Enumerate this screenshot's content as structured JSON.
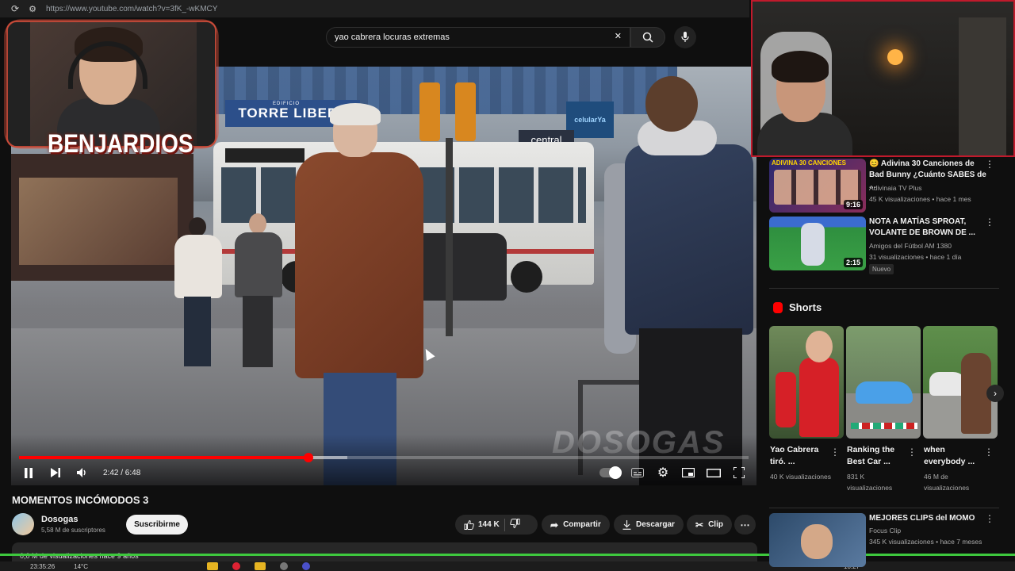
{
  "browser": {
    "url": "https://www.youtube.com/watch?v=3fK_-wKMCY"
  },
  "search": {
    "query": "yao cabrera locuras extremas"
  },
  "overlay": {
    "streamer_name": "BENJARDIOS"
  },
  "video": {
    "watermark": "DOSOGAS",
    "signs": {
      "building": "TORRE LIBERT",
      "building_sub": "EDIFICIO",
      "shop": "central",
      "shop2": "celularYa",
      "left_sign": "AD"
    },
    "time": "2:42 / 6:48",
    "progress_fraction": 0.397,
    "buffered_fraction": 0.45
  },
  "info": {
    "title": "MOMENTOS INCÓMODOS 3",
    "channel": "Dosogas",
    "subscribers": "5,58 M de suscriptores",
    "subscribe_label": "Suscribirme",
    "likes": "144 K",
    "share_label": "Compartir",
    "download_label": "Descargar",
    "clip_label": "Clip",
    "views_line": "0,0 M de visualizaciones  hace 9 años"
  },
  "sidebar": {
    "videos": [
      {
        "title": "😊 Adivina 30 Canciones de Bad Bunny ¿Cuánto SABES de ...",
        "channel": "Adivinaia TV Plus",
        "meta": "45 K visualizaciones • hace 1 mes",
        "duration": "9:16",
        "thumb_text": "ADIVINA 30 CANCIONES"
      },
      {
        "title": "NOTA A MATÍAS SPROAT, VOLANTE DE BROWN DE ...",
        "channel": "Amigos del Fútbol AM 1380",
        "meta": "31 visualizaciones • hace 1 día",
        "duration": "2:15",
        "badge": "Nuevo"
      },
      {
        "title": "MEJORES CLIPS del MOMO",
        "channel": "Focus Clip",
        "meta": "345 K visualizaciones • hace 7 meses"
      }
    ],
    "shorts_heading": "Shorts",
    "shorts": [
      {
        "title": "Yao Cabrera tiró. ...",
        "views": "40 K visualizaciones"
      },
      {
        "title": "Ranking the Best Car ...",
        "views": "831 K visualizaciones"
      },
      {
        "title": "when everybody ...",
        "views": "46 M de visualizaciones"
      }
    ]
  },
  "taskbar": {
    "left_text": "23:35:26",
    "left_text2": "14°C",
    "clock": "10:27"
  }
}
